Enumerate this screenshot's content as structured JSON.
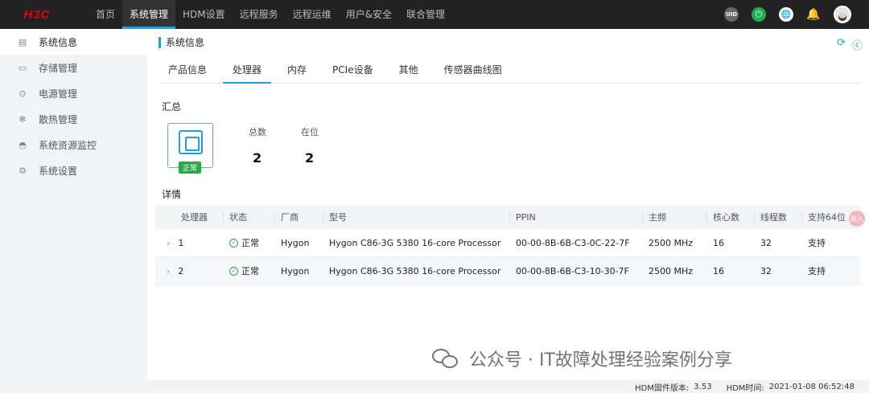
{
  "header": {
    "logo": "H3C",
    "nav": [
      "首页",
      "系统管理",
      "HDM设置",
      "远程服务",
      "远程运维",
      "用户&安全",
      "联合管理"
    ],
    "active_nav": "系统管理",
    "icons": [
      "uid-icon",
      "power-icon",
      "language-icon",
      "bell-icon",
      "avatar"
    ],
    "uid_label": "UID"
  },
  "sidebar": {
    "items": [
      {
        "label": "系统信息",
        "icon": "document-icon"
      },
      {
        "label": "存储管理",
        "icon": "storage-icon"
      },
      {
        "label": "电源管理",
        "icon": "power-supply-icon"
      },
      {
        "label": "散热管理",
        "icon": "fan-icon"
      },
      {
        "label": "系统资源监控",
        "icon": "monitor-icon"
      },
      {
        "label": "系统设置",
        "icon": "gear-icon"
      }
    ]
  },
  "main": {
    "breadcrumb": "系统信息",
    "tabs": [
      "产品信息",
      "处理器",
      "内存",
      "PCIe设备",
      "其他",
      "传感器曲线图"
    ],
    "active_tab": "处理器",
    "summary": {
      "title": "汇总",
      "status_badge": "正常",
      "total_label": "总数",
      "total_value": "2",
      "present_label": "在位",
      "present_value": "2"
    },
    "details": {
      "title": "详情",
      "columns": [
        "处理器",
        "状态",
        "厂商",
        "型号",
        "PPIN",
        "主频",
        "核心数",
        "线程数",
        "支持64位"
      ],
      "rows": [
        {
          "id": "1",
          "status": "正常",
          "vendor": "Hygon",
          "model": "Hygon C86-3G 5380 16-core Processor",
          "ppin": "00-00-8B-6B-C3-0C-22-7F",
          "freq": "2500 MHz",
          "cores": "16",
          "threads": "32",
          "x64": "支持"
        },
        {
          "id": "2",
          "status": "正常",
          "vendor": "Hygon",
          "model": "Hygon C86-3G 5380 16-core Processor",
          "ppin": "00-00-8B-6B-C3-10-30-7F",
          "freq": "2500 MHz",
          "cores": "16",
          "threads": "32",
          "x64": "支持"
        }
      ]
    }
  },
  "footer": {
    "firmware_label": "HDM固件版本:",
    "firmware_value": "3.53",
    "time_label": "HDM时间:",
    "time_value": "2021-01-08 06:52:48"
  },
  "watermark": "公众号 · IT故障处理经验案例分享",
  "float_button": "收入",
  "colors": {
    "accent": "#1aa3d8",
    "ok": "#2aa84a",
    "nav_bg": "#222222",
    "logo": "#e60012"
  }
}
